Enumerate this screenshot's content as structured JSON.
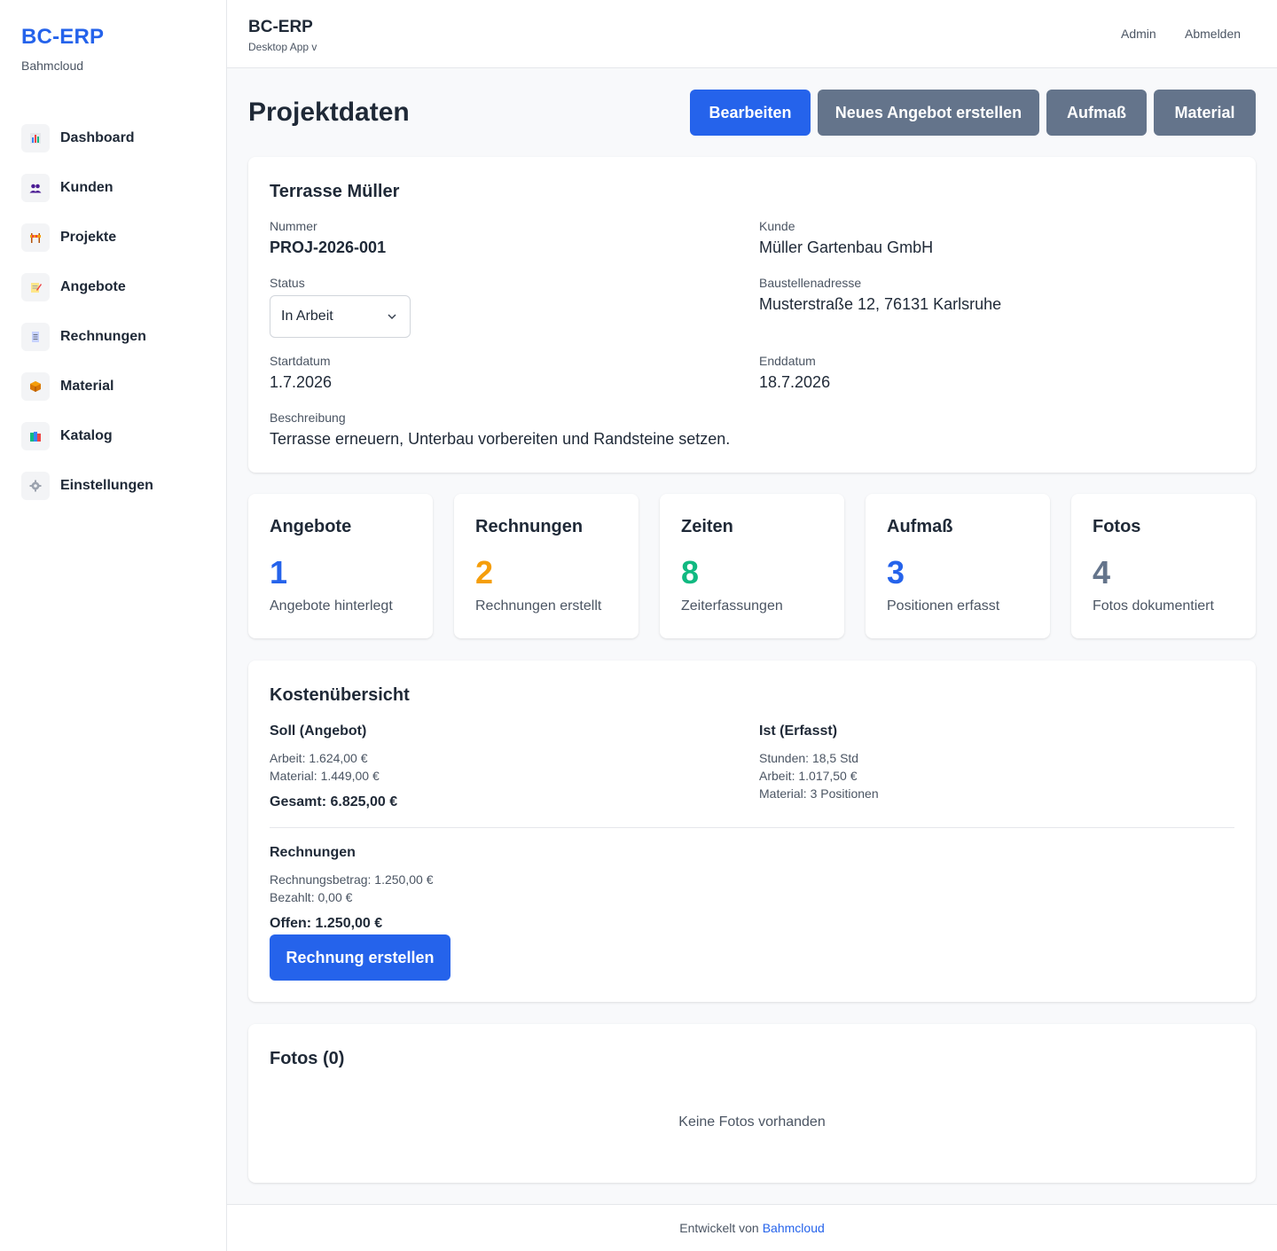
{
  "brand": {
    "title": "BC-ERP",
    "subtitle": "Bahmcloud"
  },
  "sidebar": {
    "items": [
      {
        "label": "Dashboard",
        "icon": "chart-icon"
      },
      {
        "label": "Kunden",
        "icon": "users-icon"
      },
      {
        "label": "Projekte",
        "icon": "construction-icon"
      },
      {
        "label": "Angebote",
        "icon": "memo-icon"
      },
      {
        "label": "Rechnungen",
        "icon": "receipt-icon"
      },
      {
        "label": "Material",
        "icon": "package-icon"
      },
      {
        "label": "Katalog",
        "icon": "books-icon"
      },
      {
        "label": "Einstellungen",
        "icon": "gear-icon"
      }
    ]
  },
  "topbar": {
    "title": "BC-ERP",
    "subtitle": "Desktop App v",
    "user_label": "Admin",
    "logout_label": "Abmelden"
  },
  "page": {
    "title": "Projektdaten",
    "actions": {
      "edit": "Bearbeiten",
      "new_offer": "Neues Angebot erstellen",
      "measurement": "Aufmaß",
      "material": "Material"
    }
  },
  "project": {
    "name": "Terrasse Müller",
    "number_label": "Nummer",
    "number": "PROJ-2026-001",
    "customer_label": "Kunde",
    "customer": "Müller Gartenbau GmbH",
    "status_label": "Status",
    "status": "In Arbeit",
    "address_label": "Baustellenadresse",
    "address": "Musterstraße 12, 76131 Karlsruhe",
    "start_label": "Startdatum",
    "start": "1.7.2026",
    "end_label": "Enddatum",
    "end": "18.7.2026",
    "description_label": "Beschreibung",
    "description": "Terrasse erneuern, Unterbau vorbereiten und Randsteine setzen."
  },
  "stats": [
    {
      "title": "Angebote",
      "value": "1",
      "desc": "Angebote hinterlegt",
      "color": "#2563eb"
    },
    {
      "title": "Rechnungen",
      "value": "2",
      "desc": "Rechnungen erstellt",
      "color": "#f59e0b"
    },
    {
      "title": "Zeiten",
      "value": "8",
      "desc": "Zeiterfassungen",
      "color": "#10b981"
    },
    {
      "title": "Aufmaß",
      "value": "3",
      "desc": "Positionen erfasst",
      "color": "#2563eb"
    },
    {
      "title": "Fotos",
      "value": "4",
      "desc": "Fotos dokumentiert",
      "color": "#64748b"
    }
  ],
  "costs": {
    "title": "Kostenübersicht",
    "planned": {
      "heading": "Soll (Angebot)",
      "labor": "Arbeit: 1.624,00 €",
      "material": "Material: 1.449,00 €",
      "total": "Gesamt: 6.825,00 €"
    },
    "actual": {
      "heading": "Ist (Erfasst)",
      "hours": "Stunden: 18,5 Std",
      "labor": "Arbeit: 1.017,50 €",
      "material": "Material: 3 Positionen"
    },
    "invoices": {
      "heading": "Rechnungen",
      "amount": "Rechnungsbetrag: 1.250,00 €",
      "paid": "Bezahlt: 0,00 €",
      "open": "Offen: 1.250,00 €",
      "button": "Rechnung erstellen"
    }
  },
  "photos": {
    "title": "Fotos (0)",
    "empty": "Keine Fotos vorhanden"
  },
  "footer": {
    "text": "Entwickelt von",
    "link": "Bahmcloud"
  }
}
